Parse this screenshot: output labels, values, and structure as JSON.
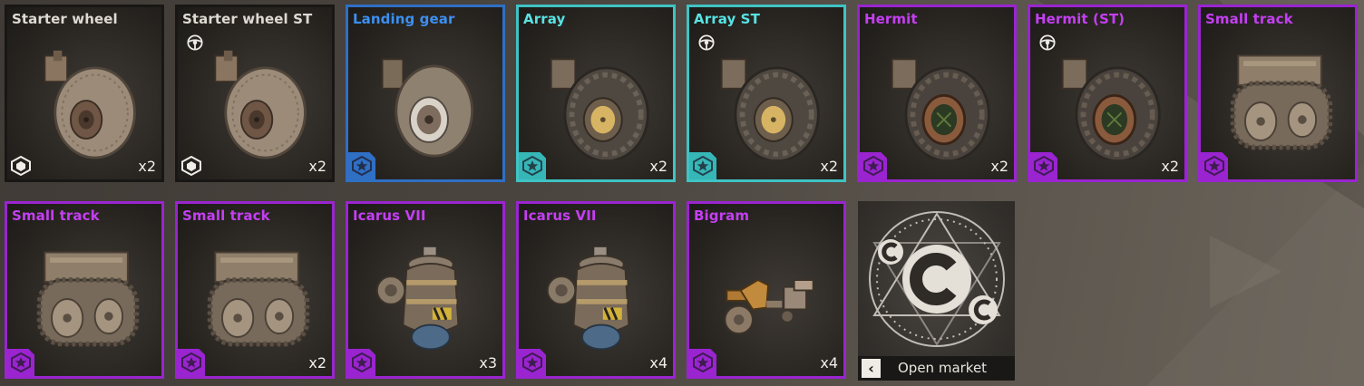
{
  "items": [
    {
      "name": "Starter wheel",
      "rarity": "common",
      "st": false,
      "qty": "x2",
      "art": "wheel-plain"
    },
    {
      "name": "Starter wheel ST",
      "rarity": "common",
      "st": true,
      "qty": "x2",
      "art": "wheel-plain"
    },
    {
      "name": "Landing gear",
      "rarity": "rare",
      "st": false,
      "qty": "",
      "art": "wheel-landing"
    },
    {
      "name": "Array",
      "rarity": "special",
      "st": false,
      "qty": "x2",
      "art": "wheel-array"
    },
    {
      "name": "Array ST",
      "rarity": "special",
      "st": true,
      "qty": "x2",
      "art": "wheel-array"
    },
    {
      "name": "Hermit",
      "rarity": "epic",
      "st": false,
      "qty": "x2",
      "art": "wheel-hermit"
    },
    {
      "name": "Hermit (ST)",
      "rarity": "epic",
      "st": true,
      "qty": "x2",
      "art": "wheel-hermit"
    },
    {
      "name": "Small track",
      "rarity": "epic",
      "st": false,
      "qty": "",
      "art": "track"
    },
    {
      "name": "Small track",
      "rarity": "epic",
      "st": false,
      "qty": "",
      "art": "track"
    },
    {
      "name": "Small track",
      "rarity": "epic",
      "st": false,
      "qty": "x2",
      "art": "track"
    },
    {
      "name": "Icarus VII",
      "rarity": "epic",
      "st": false,
      "qty": "x3",
      "art": "hover"
    },
    {
      "name": "Icarus VII",
      "rarity": "epic",
      "st": false,
      "qty": "x4",
      "art": "hover"
    },
    {
      "name": "Bigram",
      "rarity": "epic",
      "st": false,
      "qty": "x4",
      "art": "bigram"
    }
  ],
  "market": {
    "label": "Open market",
    "chevron": "‹",
    "logo_icon": "coin-c-emblem-icon"
  },
  "colors": {
    "common": "#191715",
    "rare": "#2f6fc4",
    "special": "#3fc3c4",
    "epic": "#9a24d0"
  },
  "icons": {
    "st": "steering-wheel-icon",
    "badge_common": "hex-cube-icon",
    "badge_rarity": "star-badge-icon"
  }
}
